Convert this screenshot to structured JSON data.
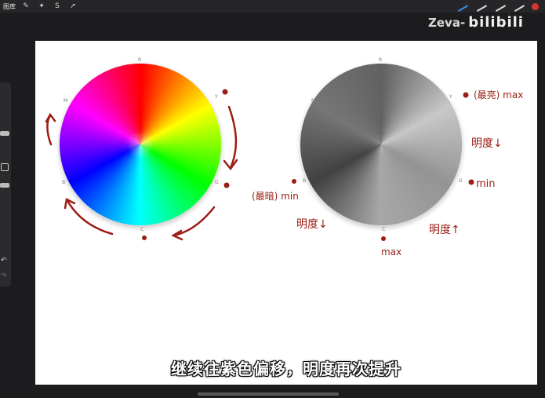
{
  "toolbar": {
    "gallery_label": "图库"
  },
  "watermark": {
    "author": "Zeva-",
    "brand": "bilibili"
  },
  "color_wheel": {
    "markers": {
      "top": "R",
      "upper_right": "Y",
      "right": "G",
      "bottom": "C",
      "left": "B",
      "upper_left": "M"
    }
  },
  "gray_wheel": {
    "markers": {
      "top": "R",
      "upper_right": "Y",
      "right": "G",
      "bottom": "C",
      "left": "B",
      "upper_left": "M"
    }
  },
  "annotations": {
    "brightest_max": "(最亮) max",
    "brightness_down_right": "明度↓",
    "min_right": "min",
    "darkest_min": "(最暗) min",
    "brightness_down_left": "明度↓",
    "brightness_up": "明度↑",
    "max_bottom": "max"
  },
  "subtitle": "继续往紫色偏移，明度再次提升",
  "colors": {
    "annotation": "#9b1d14",
    "canvas": "#ffffff",
    "app_bg": "#1c1c1e"
  }
}
